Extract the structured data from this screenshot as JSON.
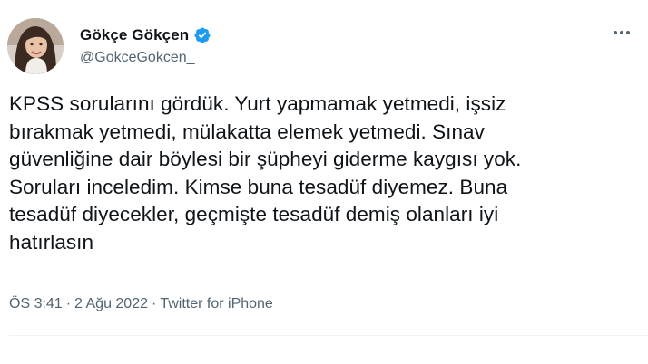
{
  "user": {
    "display_name": "Gökçe Gökçen",
    "handle": "@GokceGokcen_",
    "verified": true
  },
  "icons": {
    "avatar": "profile-photo",
    "verified": "verified-badge-icon",
    "more": "more-options-icon"
  },
  "tweet": {
    "text": "KPSS sorularını gördük. Yurt yapmamak yetmedi, işsiz\nbırakmak yetmedi, mülakatta elemek yetmedi. Sınav\ngüvenliğine dair böylesi bir şüpheyi giderme kaygısı yok.\nSoruları inceledim. Kimse buna tesadüf diyemez. Buna\ntesadüf diyecekler, geçmişte tesadüf demiş olanları iyi\nhatırlasın",
    "time": "ÖS 3:41",
    "date": "2 Ağu 2022",
    "separator": "·",
    "source": "Twitter for iPhone"
  },
  "colors": {
    "text": "#0f1419",
    "secondary": "#536471",
    "verified": "#1d9bf0",
    "divider": "#eff3f4"
  }
}
